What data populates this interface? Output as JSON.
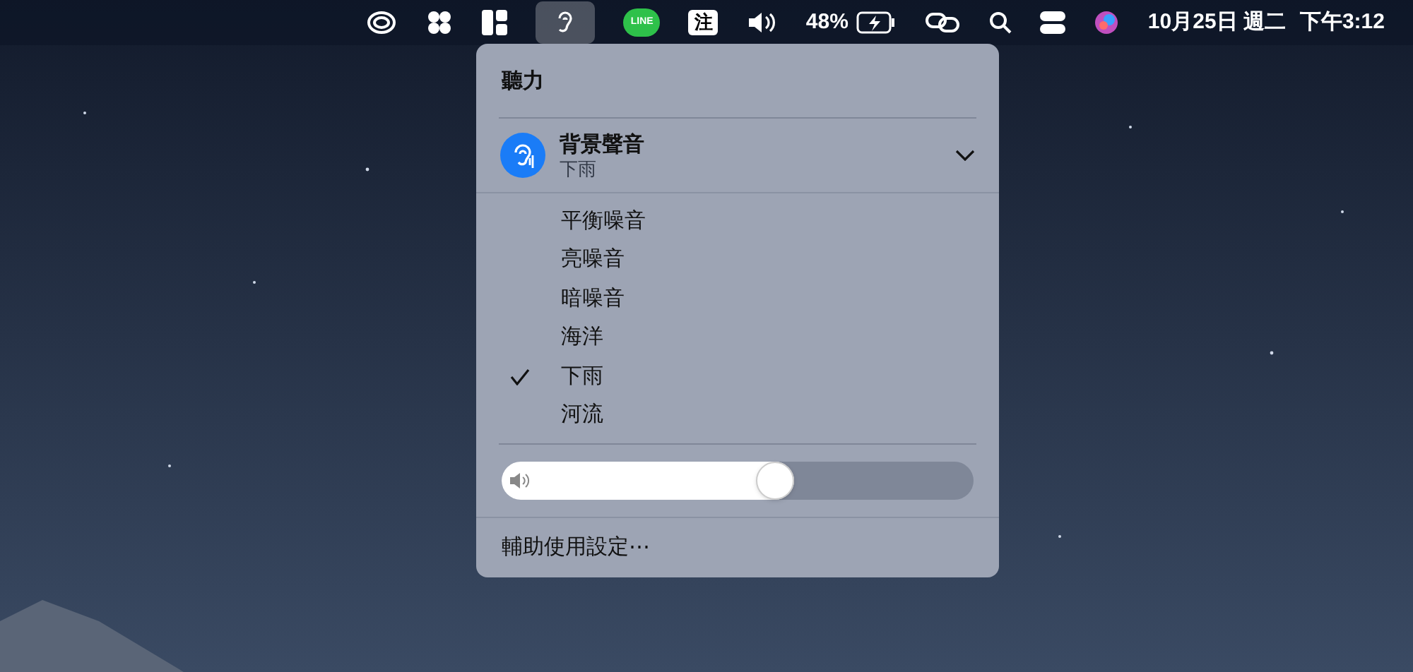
{
  "menubar": {
    "hearing_selected": true,
    "line_label": "LINE",
    "input_method": "注",
    "battery": "48%",
    "date": "10月25日 週二",
    "time": "下午3:12"
  },
  "panel": {
    "title": "聽力",
    "sound": {
      "title": "背景聲音",
      "value": "下雨"
    },
    "options": [
      {
        "label": "平衡噪音",
        "selected": false
      },
      {
        "label": "亮噪音",
        "selected": false
      },
      {
        "label": "暗噪音",
        "selected": false
      },
      {
        "label": "海洋",
        "selected": false
      },
      {
        "label": "下雨",
        "selected": true
      },
      {
        "label": "河流",
        "selected": false
      }
    ],
    "volume": {
      "level": 0.62
    },
    "footer": "輔助使用設定⋯"
  }
}
